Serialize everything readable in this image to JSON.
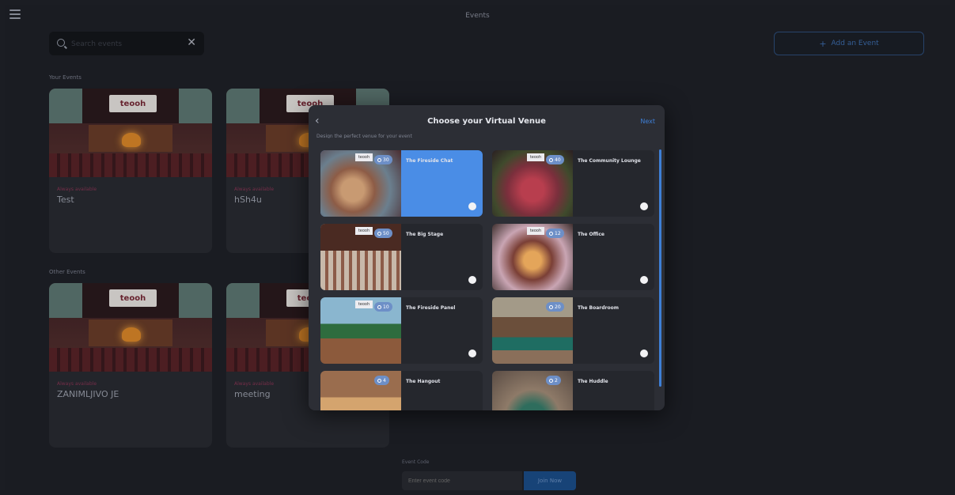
{
  "app": {
    "title": "Events"
  },
  "search": {
    "placeholder": "Search events",
    "value": ""
  },
  "header": {
    "add_event_label": "Add an Event"
  },
  "sections": {
    "your_events": "Your Events",
    "other_events": "Other Events"
  },
  "logo_text": "teooh",
  "your_events": [
    {
      "status": "Always available",
      "name": "Test"
    },
    {
      "status": "Always available",
      "name": "hSh4u"
    }
  ],
  "other_events": [
    {
      "status": "Always available",
      "name": "ZANIMLJIVO JE"
    },
    {
      "status": "Always available",
      "name": "meeting"
    }
  ],
  "event_code": {
    "label": "Event Code",
    "placeholder": "Enter event code",
    "join_label": "Join Now"
  },
  "modal": {
    "title": "Choose your Virtual Venue",
    "next_label": "Next",
    "subtitle": "Design the perfect venue for your event",
    "venues": [
      {
        "name": "The Fireside Chat",
        "capacity": "30",
        "selected": true
      },
      {
        "name": "The Community Lounge",
        "capacity": "40",
        "selected": false
      },
      {
        "name": "The Big Stage",
        "capacity": "50",
        "selected": false
      },
      {
        "name": "The Office",
        "capacity": "12",
        "selected": false
      },
      {
        "name": "The Fireside Panel",
        "capacity": "10",
        "selected": false
      },
      {
        "name": "The Boardroom",
        "capacity": "20",
        "selected": false
      },
      {
        "name": "The Hangout",
        "capacity": "4",
        "selected": false
      },
      {
        "name": "The Huddle",
        "capacity": "2",
        "selected": false
      }
    ]
  },
  "colors": {
    "accent": "#3e7fd6",
    "selected_card": "#4a8de6",
    "status": "#8a3656",
    "background": "#1f2128"
  }
}
